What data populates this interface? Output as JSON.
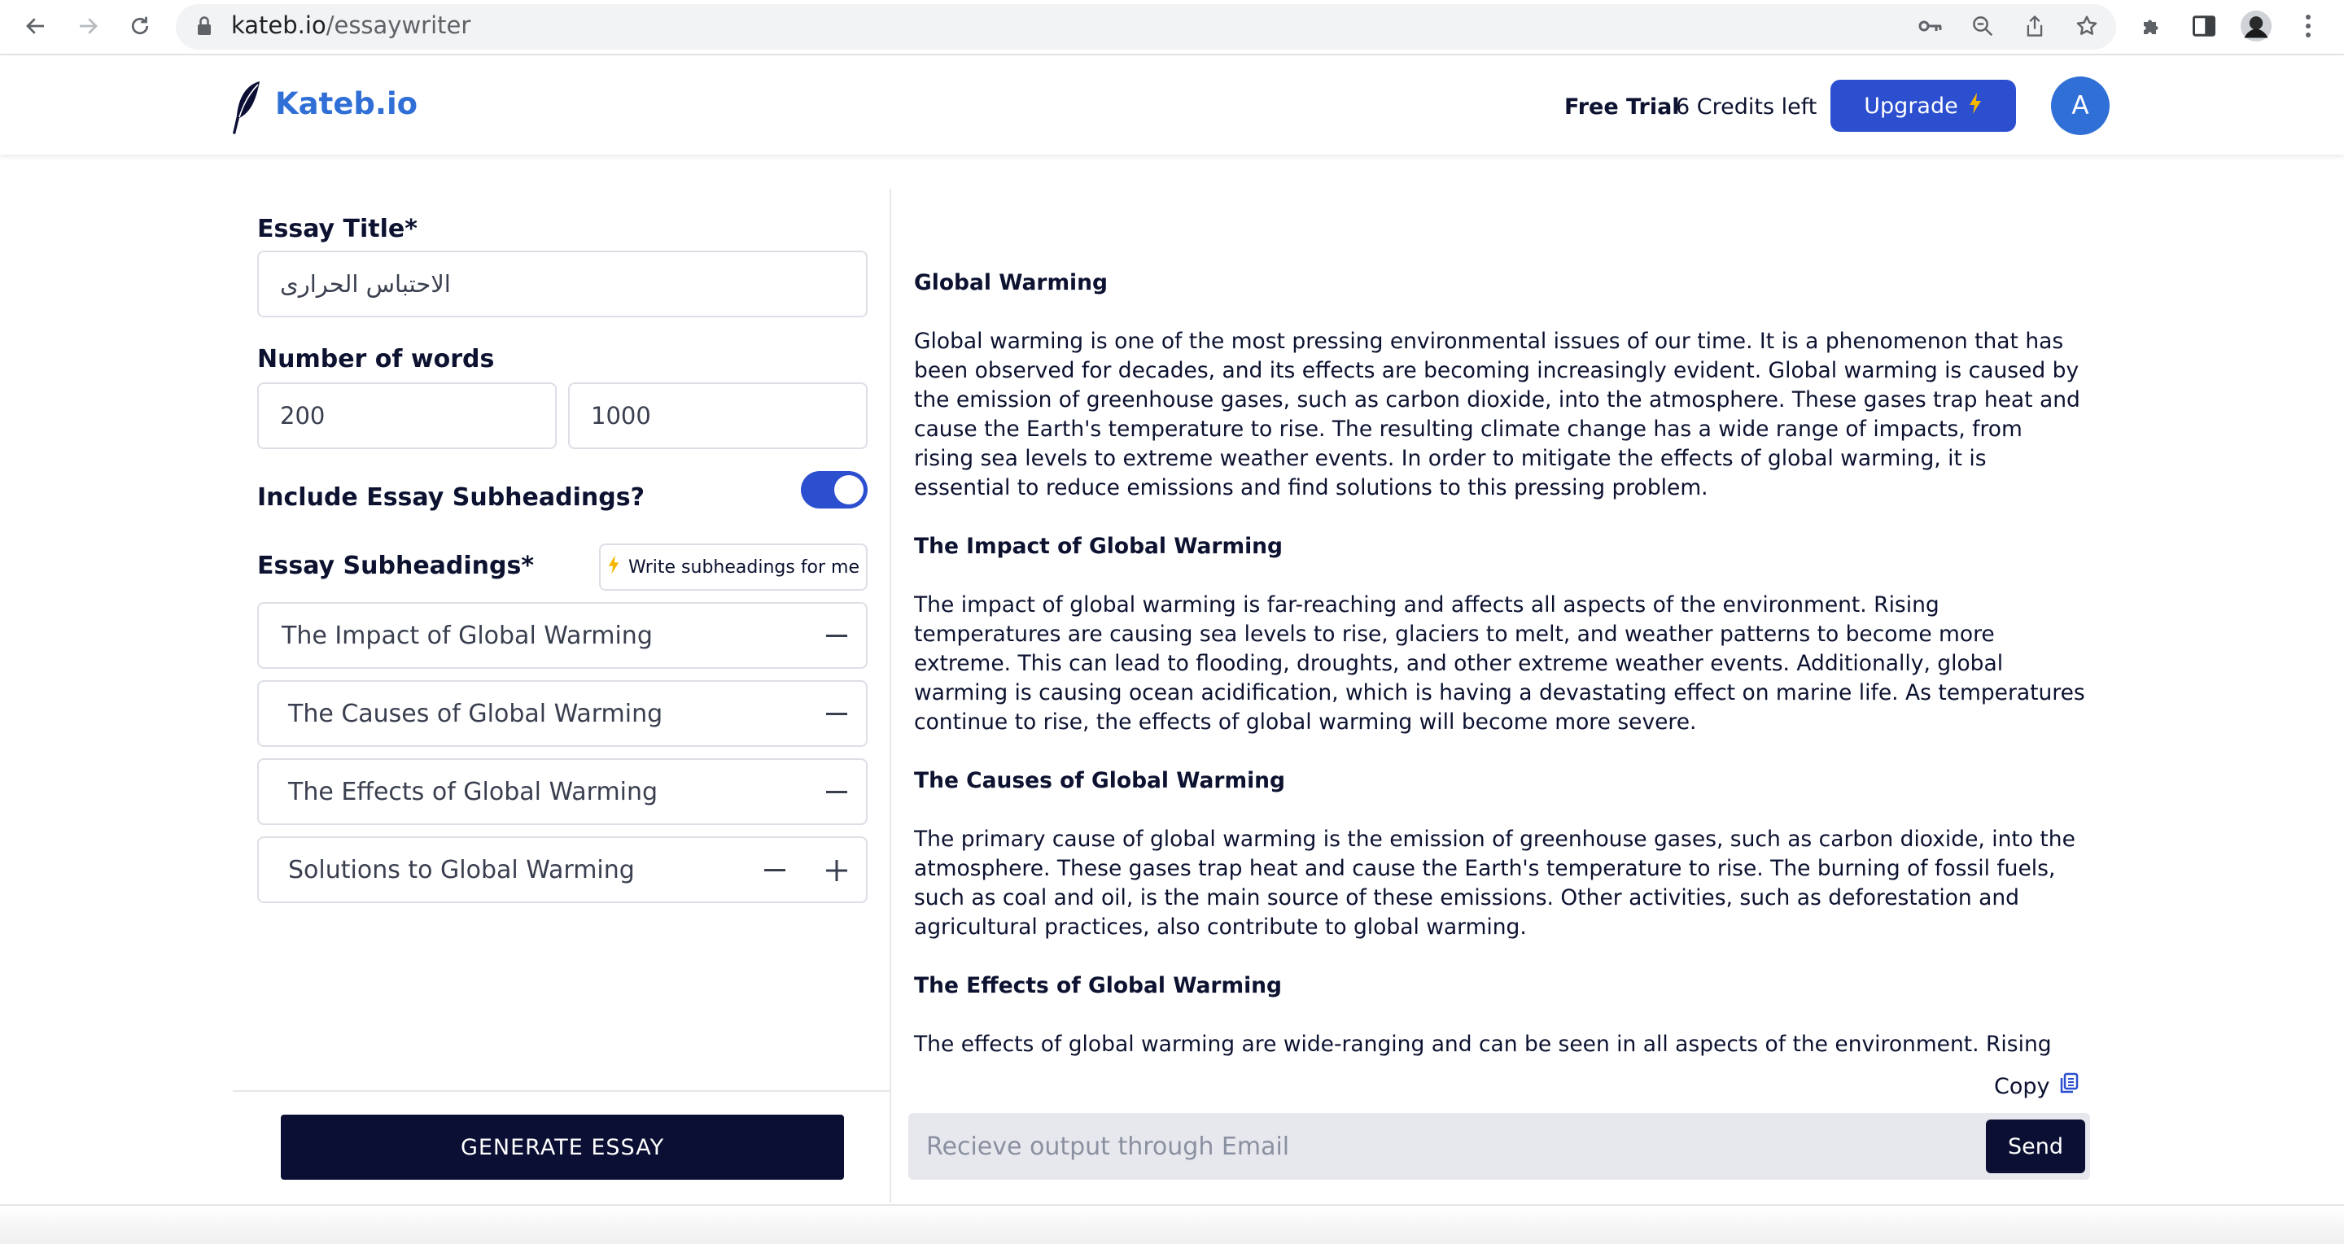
{
  "browser": {
    "url_host": "kateb.io",
    "url_path": "/essaywriter"
  },
  "header": {
    "brand": "Kateb.io",
    "plan_label": "Free Trial",
    "credits": "6 Credits left",
    "upgrade_label": "Upgrade",
    "avatar_initial": "A"
  },
  "form": {
    "title_label": "Essay Title*",
    "title_value": "الاحتباس الحرارى",
    "words_label": "Number of words",
    "words_min": "200",
    "words_max": "1000",
    "subheadings_toggle_label": "Include Essay Subheadings?",
    "subheadings_toggle_on": true,
    "subheadings_label": "Essay Subheadings*",
    "write_subheadings_label": "Write subheadings for me",
    "subheadings": [
      "The Impact of Global Warming",
      "The Causes of Global Warming",
      "The Effects of Global Warming",
      "Solutions to Global Warming"
    ],
    "generate_label": "GENERATE ESSAY"
  },
  "output": {
    "title": "Global Warming",
    "intro": "Global warming is one of the most pressing environmental issues of our time. It is a phenomenon that has been observed for decades, and its effects are becoming increasingly evident. Global warming is caused by the emission of greenhouse gases, such as carbon dioxide, into the atmosphere. These gases trap heat and cause the Earth's temperature to rise. The resulting climate change has a wide range of impacts, from rising sea levels to extreme weather events. In order to mitigate the effects of global warming, it is essential to reduce emissions and find solutions to this pressing problem.",
    "sections": [
      {
        "heading": "The Impact of Global Warming",
        "body": "The impact of global warming is far-reaching and affects all aspects of the environment. Rising temperatures are causing sea levels to rise, glaciers to melt, and weather patterns to become more extreme. This can lead to flooding, droughts, and other extreme weather events. Additionally, global warming is causing ocean acidification, which is having a devastating effect on marine life. As temperatures continue to rise, the effects of global warming will become more severe."
      },
      {
        "heading": "The Causes of Global Warming",
        "body": "The primary cause of global warming is the emission of greenhouse gases, such as carbon dioxide, into the atmosphere. These gases trap heat and cause the Earth's temperature to rise. The burning of fossil fuels, such as coal and oil, is the main source of these emissions. Other activities, such as deforestation and agricultural practices, also contribute to global warming."
      },
      {
        "heading": "The Effects of Global Warming",
        "body": "The effects of global warming are wide-ranging and can be seen in all aspects of the environment. Rising"
      }
    ],
    "copy_label": "Copy",
    "email_placeholder": "Recieve output through Email",
    "send_label": "Send"
  },
  "colors": {
    "accent": "#2b4fcf",
    "brand_blue": "#2f6fd6",
    "dark_button": "#0a0f33",
    "bolt": "#f5b700"
  },
  "icons": [
    "back-arrow-icon",
    "forward-arrow-icon",
    "reload-icon",
    "lock-icon",
    "key-icon",
    "zoom-icon",
    "share-icon",
    "star-icon",
    "puzzle-icon",
    "sidebar-icon",
    "profile-icon",
    "kebab-menu-icon",
    "feather-logo-icon",
    "bolt-icon",
    "minus-icon",
    "plus-icon",
    "copy-icon"
  ]
}
